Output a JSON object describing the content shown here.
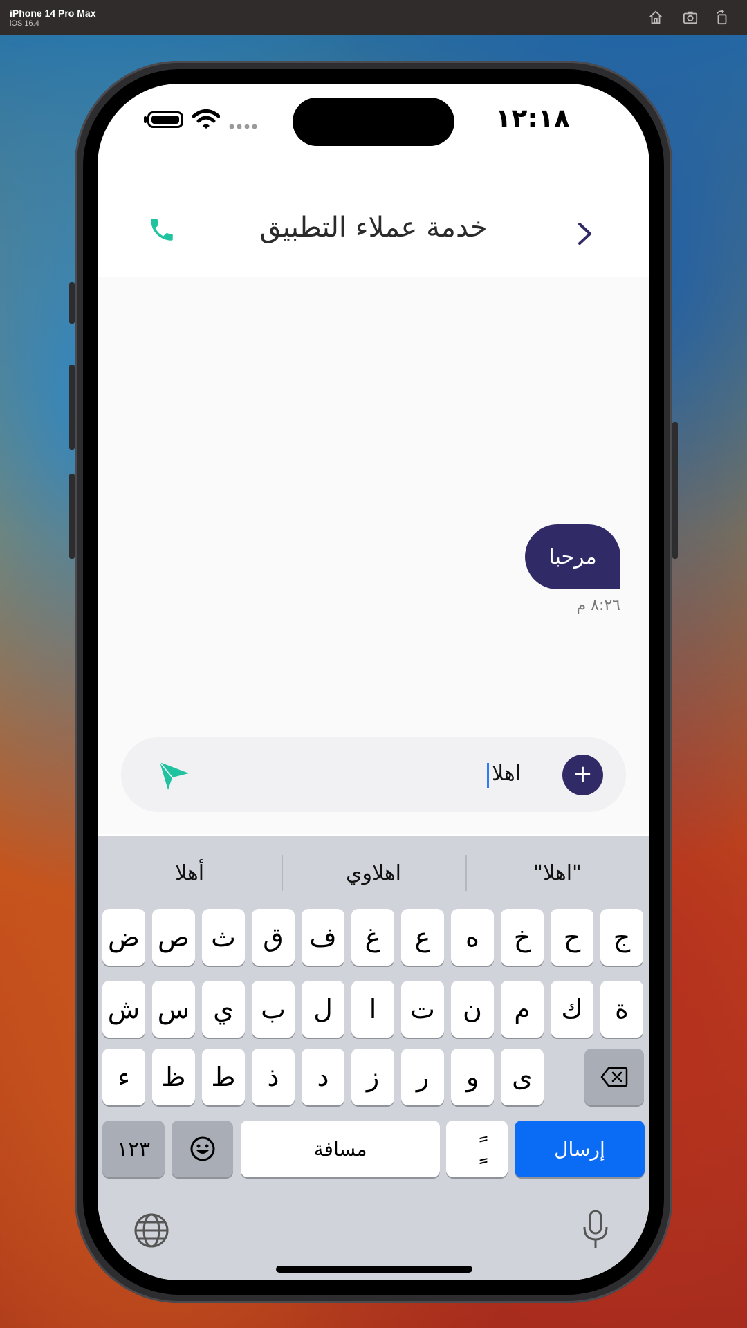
{
  "simulator": {
    "device": "iPhone 14 Pro Max",
    "os": "iOS 16.4"
  },
  "status_bar": {
    "time": "١٢:١٨"
  },
  "header": {
    "title": "خدمة عملاء التطبيق"
  },
  "chat": {
    "messages": [
      {
        "text": "مرحبا",
        "time": "٨:٢٦ م",
        "direction": "outgoing"
      }
    ]
  },
  "composer": {
    "value": "اهلا"
  },
  "keyboard": {
    "suggestions": [
      "أهلا",
      "اهلاوي",
      "\"اهلا\""
    ],
    "row1": [
      "ض",
      "ص",
      "ث",
      "ق",
      "ف",
      "غ",
      "ع",
      "ه",
      "خ",
      "ح",
      "ج"
    ],
    "row2": [
      "ش",
      "س",
      "ي",
      "ب",
      "ل",
      "ا",
      "ت",
      "ن",
      "م",
      "ك",
      "ة"
    ],
    "row3": [
      "ء",
      "ظ",
      "ط",
      "ذ",
      "د",
      "ز",
      "ر",
      "و",
      "ى"
    ],
    "numbers_key": "١٢٣",
    "space_key": "مسافة",
    "diacritic_key": "ًٍ",
    "send_key": "إرسال"
  },
  "colors": {
    "brand_primary": "#302b66",
    "accent_green": "#1fc3a0",
    "keyboard_blue": "#0a6cf5"
  }
}
